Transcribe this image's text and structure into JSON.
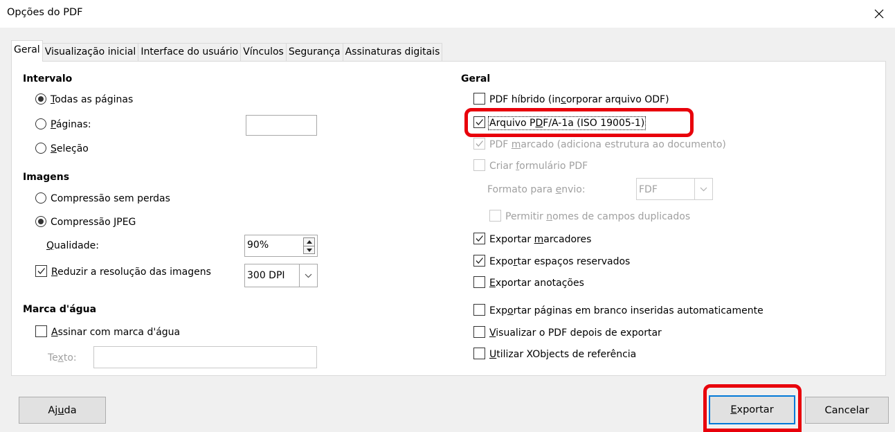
{
  "window": {
    "title": "Opções do PDF"
  },
  "tabs": [
    {
      "label": "Geral"
    },
    {
      "label": "Visualização inicial"
    },
    {
      "label": "Interface do usuário"
    },
    {
      "label": "Vínculos"
    },
    {
      "label": "Segurança"
    },
    {
      "label": "Assinaturas digitais"
    }
  ],
  "intervalo": {
    "heading": "Intervalo",
    "todas": {
      "pre": "",
      "key": "T",
      "post": "odas as páginas",
      "selected": true
    },
    "paginas": {
      "pre": "",
      "key": "P",
      "post": "áginas:",
      "selected": false,
      "value": ""
    },
    "selecao": {
      "pre": "",
      "key": "S",
      "post": "eleção",
      "selected": false
    }
  },
  "imagens": {
    "heading": "Imagens",
    "sem_perdas": {
      "label": "Compressão sem perdas",
      "selected": false
    },
    "jpeg": {
      "pre": "Compressão ",
      "key": "J",
      "post": "PEG",
      "selected": true
    },
    "qualidade": {
      "pre": "",
      "key": "Q",
      "post": "ualidade:",
      "value": "90%"
    },
    "reduzir": {
      "pre": "",
      "key": "R",
      "post": "eduzir a resolução das imagens",
      "checked": true,
      "value": "300 DPI"
    }
  },
  "marca": {
    "heading": "Marca d'água",
    "assinar": {
      "pre": "",
      "key": "A",
      "post": "ssinar com marca d'água",
      "checked": false
    },
    "texto": {
      "pre": "Te",
      "key": "x",
      "post": "to:",
      "value": ""
    }
  },
  "geral": {
    "heading": "Geral",
    "hibrido": {
      "pre": "PDF híbrido (in",
      "key": "c",
      "post": "orporar arquivo ODF)",
      "checked": false
    },
    "pdfa": {
      "pre": "Arquivo P",
      "key": "D",
      "post": "F/A-1a (ISO 19005-1)",
      "checked": true
    },
    "marcado": {
      "pre": "PDF ",
      "key": "m",
      "post": "arcado (adiciona estrutura ao documento)",
      "checked": true
    },
    "formulario": {
      "pre": "Criar ",
      "key": "f",
      "post": "ormulário PDF",
      "checked": false
    },
    "formato": {
      "pre": "Formato para ",
      "key": "e",
      "post": "nvio:",
      "value": "FDF"
    },
    "nomes": {
      "pre": "Permitir ",
      "key": "n",
      "post": "omes de campos duplicados",
      "checked": false
    },
    "marcadores": {
      "pre": "Exportar ",
      "key": "m",
      "post": "arcadores",
      "checked": true
    },
    "espacos": {
      "pre": "Expo",
      "key": "r",
      "post": "tar espaços reservados",
      "checked": true
    },
    "anotacoes": {
      "pre": "",
      "key": "E",
      "post": "xportar anotações",
      "checked": false
    },
    "branco": {
      "pre": "Exp",
      "key": "o",
      "post": "rtar páginas em branco inseridas automaticamente",
      "checked": false
    },
    "visualizar": {
      "pre": "",
      "key": "V",
      "post": "isualizar o PDF depois de exportar",
      "checked": false
    },
    "xobjects": {
      "pre": "",
      "key": "U",
      "post": "tilizar XObjects de referência",
      "checked": false
    }
  },
  "buttons": {
    "ajuda": {
      "pre": "Aj",
      "key": "u",
      "post": "da"
    },
    "exportar": {
      "pre": "",
      "key": "E",
      "post": "xportar"
    },
    "cancelar": {
      "label": "Cancelar"
    }
  },
  "colors": {
    "highlight": "#e8000b",
    "default_button": "#0078d7"
  }
}
